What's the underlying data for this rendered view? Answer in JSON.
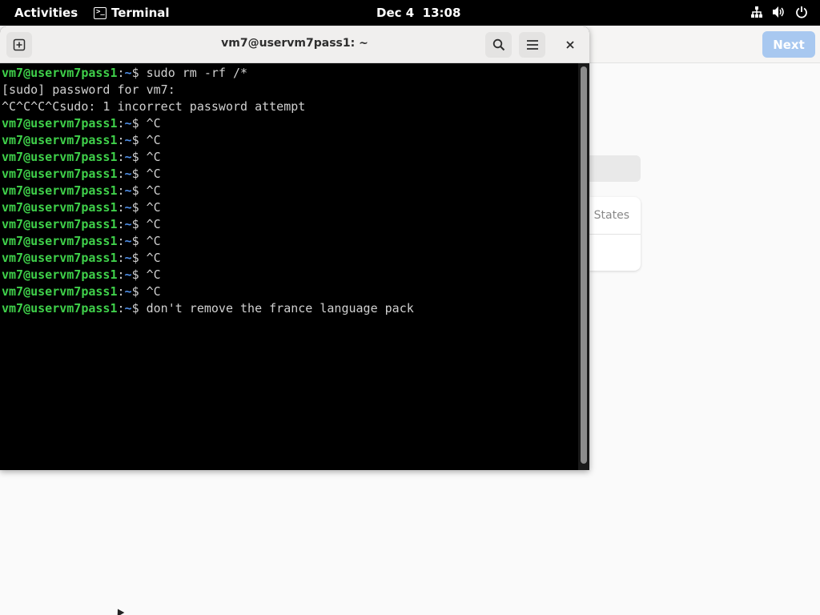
{
  "topbar": {
    "activities": "Activities",
    "app_name": "Terminal",
    "app_icon_glyph": ">_",
    "date": "Dec 4",
    "time": "13:08",
    "tray_icons": [
      "network-icon",
      "volume-icon",
      "power-icon"
    ]
  },
  "setup_window": {
    "next_label": "Next",
    "list_item": "d States"
  },
  "terminal": {
    "title": "vm7@uservm7pass1: ~",
    "lines": [
      {
        "type": "prompt",
        "user": "vm7@uservm7pass1",
        "sep": ":",
        "dir": "~",
        "sym": "$ ",
        "cmd": "sudo rm -rf /*"
      },
      {
        "type": "out",
        "text": "[sudo] password for vm7:"
      },
      {
        "type": "out",
        "text": "^C^C^C^Csudo: 1 incorrect password attempt"
      },
      {
        "type": "prompt",
        "user": "vm7@uservm7pass1",
        "sep": ":",
        "dir": "~",
        "sym": "$ ",
        "cmd": "^C"
      },
      {
        "type": "prompt",
        "user": "vm7@uservm7pass1",
        "sep": ":",
        "dir": "~",
        "sym": "$ ",
        "cmd": "^C"
      },
      {
        "type": "prompt",
        "user": "vm7@uservm7pass1",
        "sep": ":",
        "dir": "~",
        "sym": "$ ",
        "cmd": "^C"
      },
      {
        "type": "prompt",
        "user": "vm7@uservm7pass1",
        "sep": ":",
        "dir": "~",
        "sym": "$ ",
        "cmd": "^C"
      },
      {
        "type": "prompt",
        "user": "vm7@uservm7pass1",
        "sep": ":",
        "dir": "~",
        "sym": "$ ",
        "cmd": "^C"
      },
      {
        "type": "prompt",
        "user": "vm7@uservm7pass1",
        "sep": ":",
        "dir": "~",
        "sym": "$ ",
        "cmd": "^C"
      },
      {
        "type": "prompt",
        "user": "vm7@uservm7pass1",
        "sep": ":",
        "dir": "~",
        "sym": "$ ",
        "cmd": "^C"
      },
      {
        "type": "prompt",
        "user": "vm7@uservm7pass1",
        "sep": ":",
        "dir": "~",
        "sym": "$ ",
        "cmd": "^C"
      },
      {
        "type": "prompt",
        "user": "vm7@uservm7pass1",
        "sep": ":",
        "dir": "~",
        "sym": "$ ",
        "cmd": "^C"
      },
      {
        "type": "prompt",
        "user": "vm7@uservm7pass1",
        "sep": ":",
        "dir": "~",
        "sym": "$ ",
        "cmd": "^C"
      },
      {
        "type": "prompt",
        "user": "vm7@uservm7pass1",
        "sep": ":",
        "dir": "~",
        "sym": "$ ",
        "cmd": "^C"
      },
      {
        "type": "prompt",
        "user": "vm7@uservm7pass1",
        "sep": ":",
        "dir": "~",
        "sym": "$ ",
        "cmd": "don't remove the france language pack"
      }
    ]
  },
  "colors": {
    "prompt_user": "#3fd04a",
    "prompt_dir": "#4f8fe8",
    "terminal_bg": "#000000",
    "next_button": "#a8c8f0"
  }
}
